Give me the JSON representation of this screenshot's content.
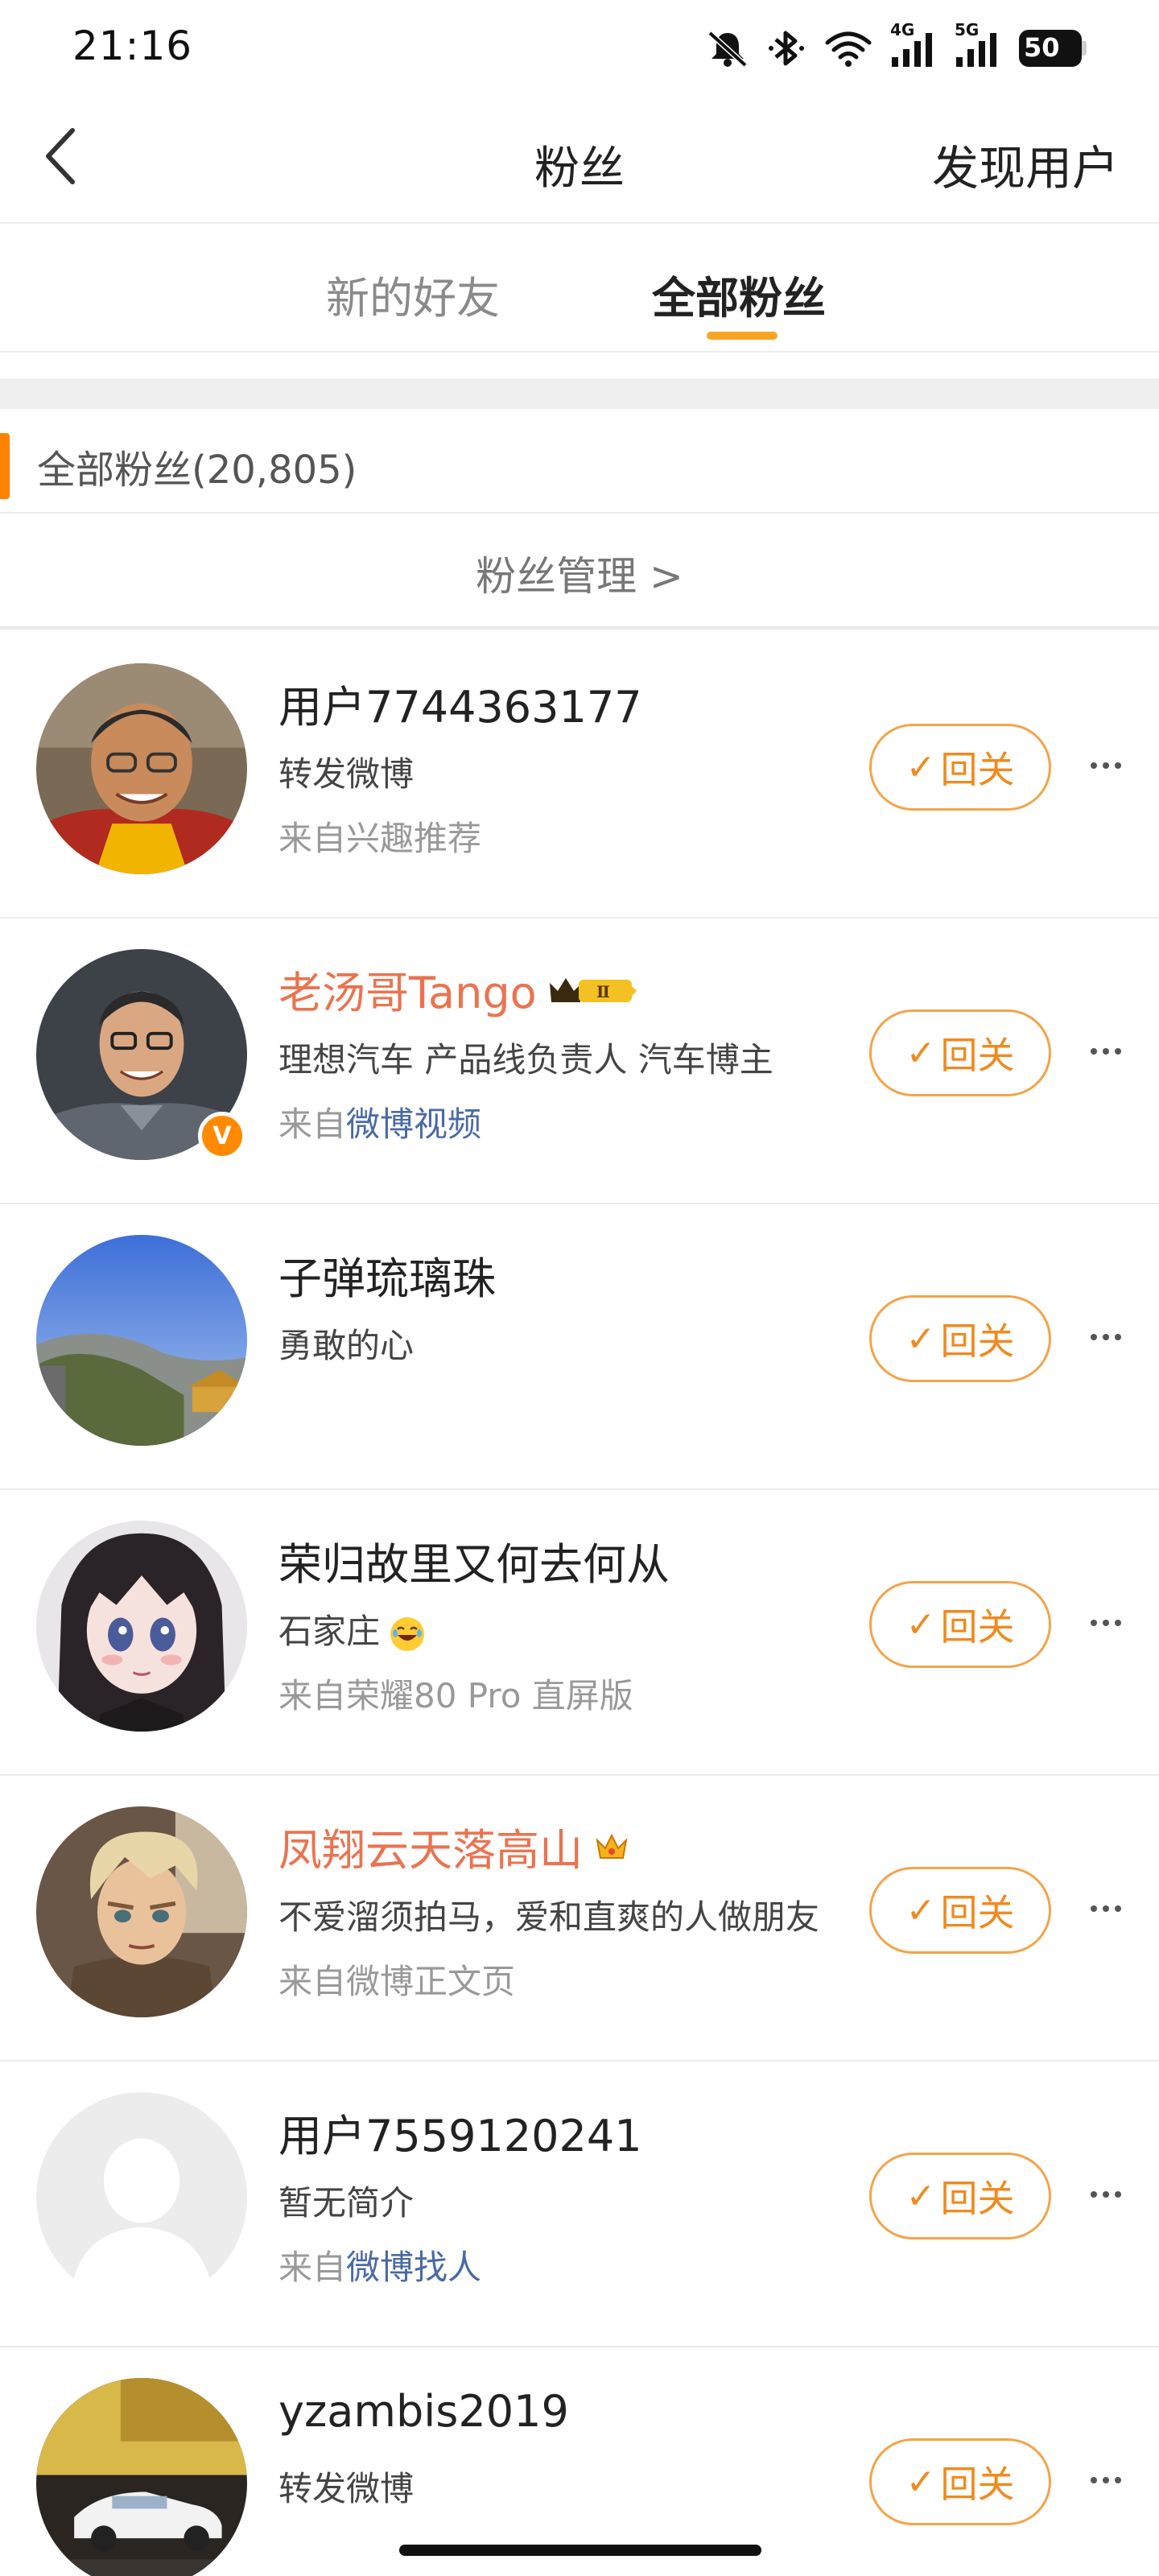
{
  "status_bar": {
    "time": "21:16",
    "net1": "4G",
    "net2": "5G",
    "battery": "50",
    "icons": [
      "mute-bell-icon",
      "bluetooth-icon",
      "wifi-icon",
      "signal-4g-icon",
      "signal-5g-icon",
      "battery-icon"
    ]
  },
  "nav": {
    "title": "粉丝",
    "right_action": "发现用户",
    "back_icon": "chevron-left-icon"
  },
  "tabs": [
    {
      "label": "新的好友",
      "active": false
    },
    {
      "label": "全部粉丝",
      "active": true
    }
  ],
  "section": {
    "title": "全部粉丝(20,805)",
    "manage_label": "粉丝管理 >"
  },
  "follow_label": "回关",
  "fans": [
    {
      "name": "用户7744363177",
      "name_color": "#222222",
      "desc": "转发微博",
      "from_prefix": "来自兴趣推荐",
      "from_link": ""
    },
    {
      "name": "老汤哥Tango",
      "name_color": "#eb7350",
      "desc": "理想汽车 产品线负责人 汽车博主",
      "from_prefix": "来自",
      "from_link": "微博视频",
      "verified": true,
      "badge": "Ⅱ"
    },
    {
      "name": "子弹琉璃珠",
      "name_color": "#222222",
      "desc": "勇敢的心",
      "from_prefix": "",
      "from_link": ""
    },
    {
      "name": "荣归故里又何去何从",
      "name_color": "#222222",
      "desc": "石家庄",
      "from_prefix": "来自荣耀80 Pro 直屏版",
      "from_link": ""
    },
    {
      "name": "凤翔云天落高山",
      "name_color": "#eb7350",
      "desc": "不爱溜须拍马，爱和直爽的人做朋友",
      "from_prefix": "来自微博正文页",
      "from_link": ""
    },
    {
      "name": "用户7559120241",
      "name_color": "#222222",
      "desc": "暂无简介",
      "from_prefix": "来自",
      "from_link": "微博找人"
    },
    {
      "name": "yzambis2019",
      "name_color": "#222222",
      "desc": "转发微博",
      "from_prefix": "",
      "from_link": ""
    }
  ],
  "colors": {
    "accent_orange": "#ff8200",
    "follow_border": "#f3a44a",
    "vip_name": "#eb7350",
    "link_blue": "#4a6aa5"
  }
}
